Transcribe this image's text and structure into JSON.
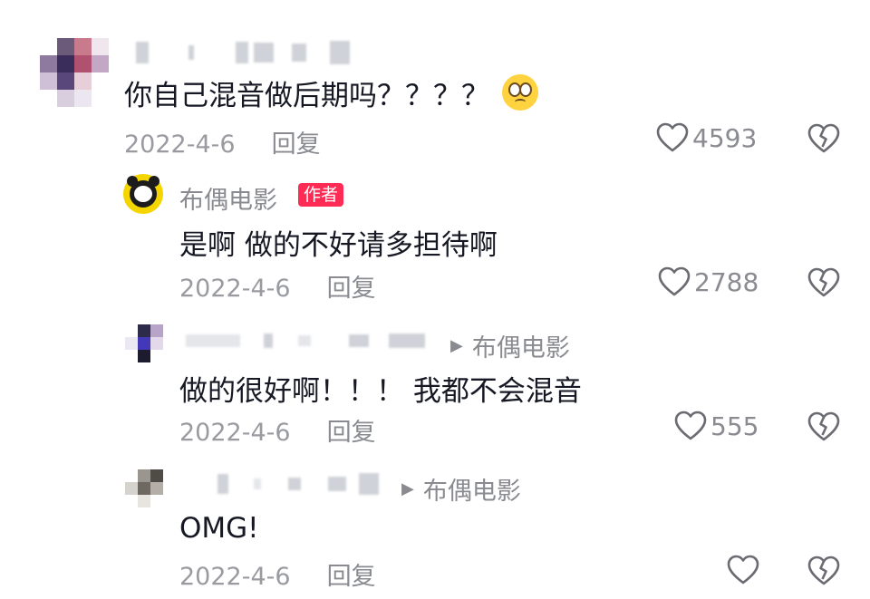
{
  "comments": [
    {
      "text": "你自己混音做后期吗？？？？",
      "emoji": "pleading-face-emoji",
      "date": "2022-4-6",
      "reply_label": "回复",
      "likes": "4593"
    },
    {
      "author": "布偶电影",
      "badge": "作者",
      "text": "是啊 做的不好请多担待啊",
      "date": "2022-4-6",
      "reply_label": "回复",
      "likes": "2788"
    },
    {
      "reply_to": "布偶电影",
      "text": "做的很好啊！！！ 我都不会混音",
      "date": "2022-4-6",
      "reply_label": "回复",
      "likes": "555"
    },
    {
      "reply_to": "布偶电影",
      "text": "OMG!",
      "date": "2022-4-6",
      "reply_label": "回复",
      "likes": ""
    }
  ],
  "colors": {
    "badge": "#fe2c55",
    "muted": "#8a8b91",
    "text": "#161823"
  }
}
